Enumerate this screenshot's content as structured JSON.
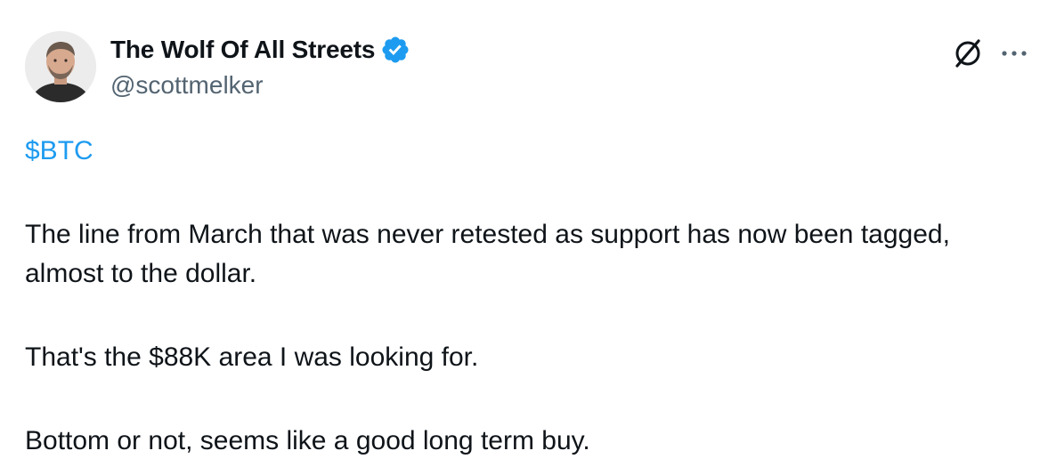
{
  "author": {
    "display_name": "The Wolf Of All Streets",
    "handle": "@scottmelker",
    "verified": true
  },
  "icons": {
    "verified": "verified-badge-icon",
    "grok": "grok-icon",
    "more": "more-options-icon"
  },
  "colors": {
    "link": "#1d9bf0",
    "text": "#0f1419",
    "secondary": "#536471",
    "verified": "#1d9bf0"
  },
  "tweet": {
    "cashtag": "$BTC",
    "paragraphs": [
      "The line from March that was never retested as support has now been tagged, almost to the dollar.",
      "That's the $88K area I was looking for.",
      "Bottom or not, seems like a good long term buy."
    ]
  }
}
